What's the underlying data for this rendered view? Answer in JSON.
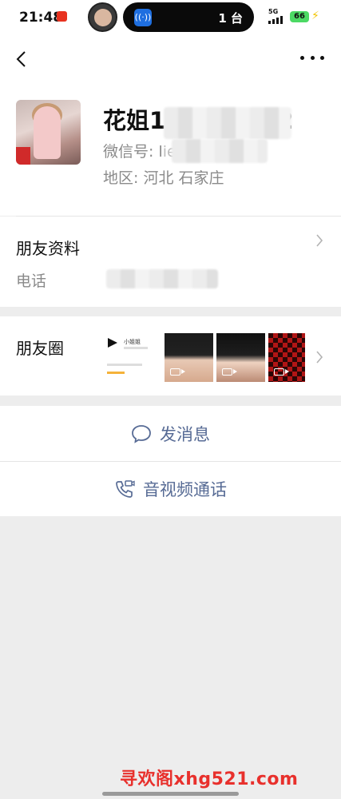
{
  "status_bar": {
    "time": "21:48",
    "island_text": "1 台",
    "network": "5G",
    "battery": "66",
    "icons": [
      "app-notification-icon",
      "floating-avatar",
      "nfc-signal-icon",
      "cellular-signal-icon",
      "battery-icon",
      "charging-bolt-icon"
    ]
  },
  "nav": {
    "back_icon": "chevron-left-icon",
    "more_icon": "more-dots-icon"
  },
  "profile": {
    "nickname": "花姐1",
    "nickname_tail": "2",
    "wechat_id_label": "微信号: l",
    "wechat_id_value": "ie5204",
    "region": "地区:  河北  石家庄"
  },
  "friend_info": {
    "title": "朋友资料",
    "phone_label": "电话"
  },
  "moments": {
    "title": "朋友圈",
    "thumb1_name": "小姐姐"
  },
  "actions": {
    "message": "发消息",
    "call": "音视频通话"
  },
  "watermark": "寻欢阁xhg521.com",
  "colors": {
    "accent": "#576b95",
    "background": "#ededed",
    "watermark": "#e8302c"
  }
}
